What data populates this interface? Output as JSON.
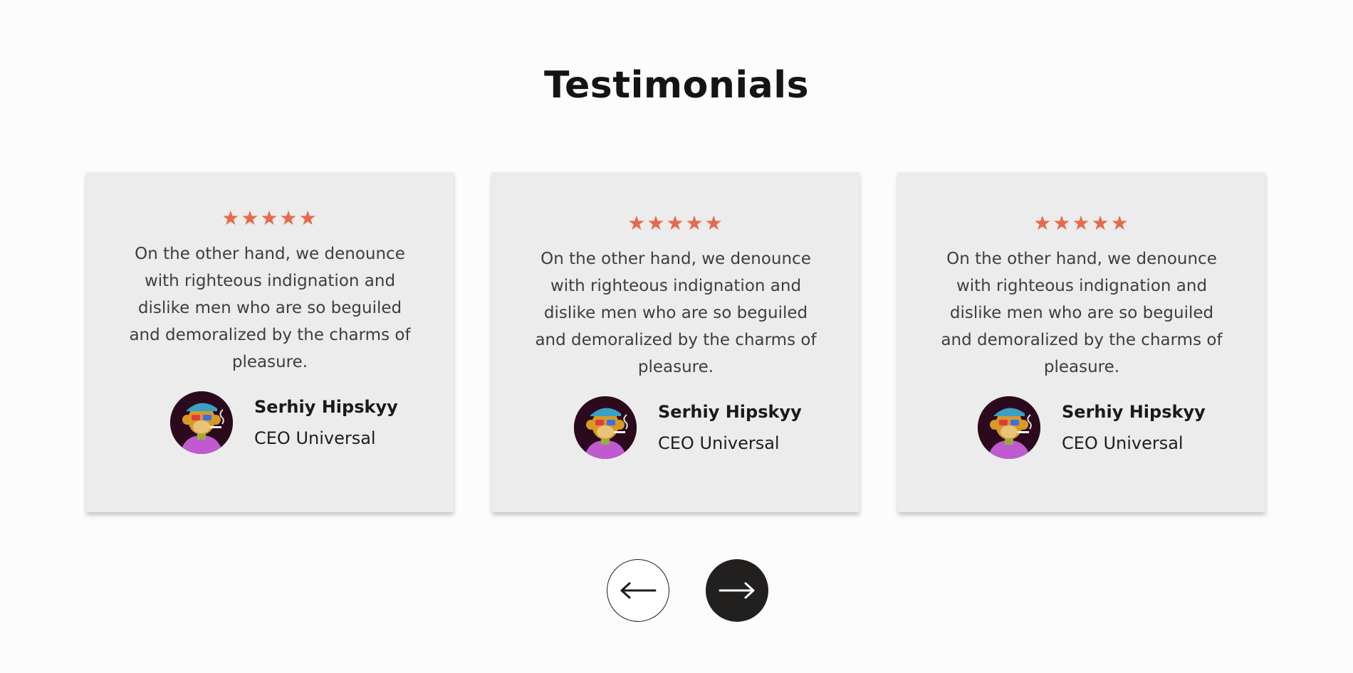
{
  "section": {
    "title": "Testimonials"
  },
  "testimonials": [
    {
      "rating": 5,
      "stars": "★★★★★",
      "quote": "On the other hand, we denounce with righteous indignation and dislike men who are so beguiled and demoralized by the charms of pleasure.",
      "author_name": "Serhiy Hipskyy",
      "author_role": "CEO Universal"
    },
    {
      "rating": 5,
      "stars": "★★★★★",
      "quote": "On the other hand, we denounce with righteous indignation and dislike men who are so beguiled and demoralized by the charms of pleasure.",
      "author_name": "Serhiy Hipskyy",
      "author_role": "CEO Universal"
    },
    {
      "rating": 5,
      "stars": "★★★★★",
      "quote": "On the other hand, we denounce with righteous indignation and dislike men who are so beguiled and demoralized by the charms of pleasure.",
      "author_name": "Serhiy Hipskyy",
      "author_role": "CEO Universal"
    }
  ],
  "navigation": {
    "prev_icon": "arrow-left-icon",
    "next_icon": "arrow-right-icon"
  },
  "colors": {
    "star": "#e8694a",
    "card_background": "#ececec",
    "next_button": "#221f1f"
  }
}
